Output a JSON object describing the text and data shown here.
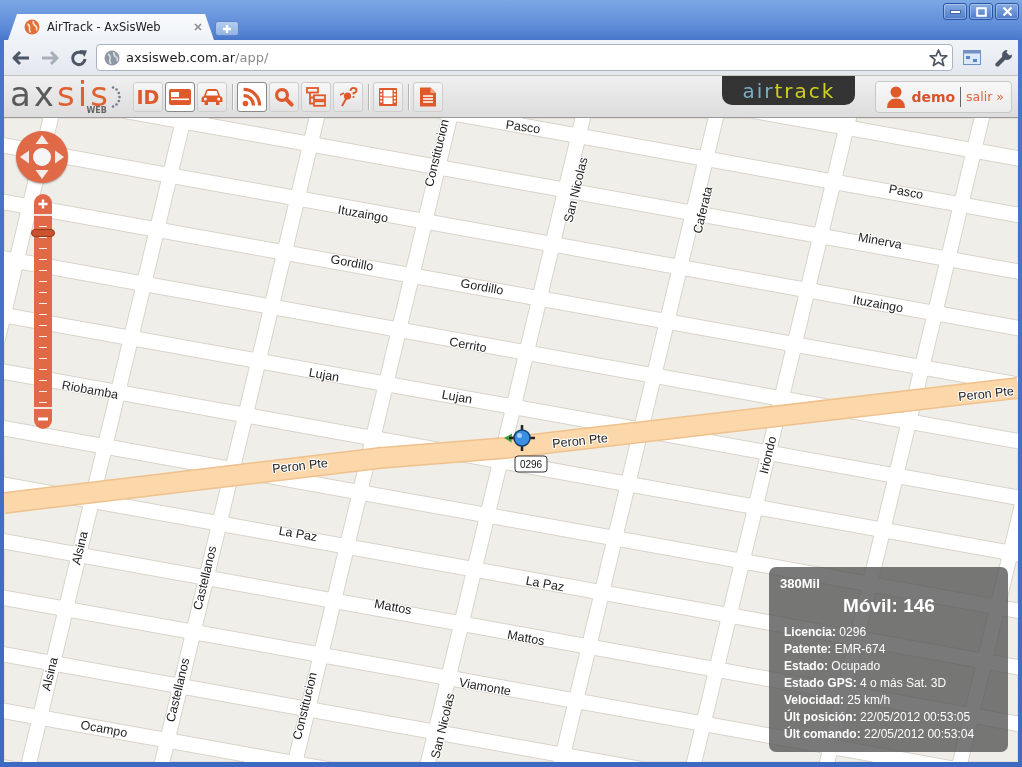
{
  "browser": {
    "tabs": [
      {
        "title": "AirTrack - AxSisWeb",
        "selected": true
      }
    ],
    "address": {
      "host": "axsisweb.com.ar",
      "path": "/app/"
    }
  },
  "app_bar": {
    "logo": {
      "parts": [
        "ax",
        "sis"
      ],
      "subtitle": "WEB"
    },
    "tool_groups": [
      [
        {
          "label": "ID",
          "selected": false
        },
        {
          "selected": true
        },
        {
          "selected": false
        }
      ],
      [
        {
          "selected": true
        },
        {
          "selected": false
        },
        {
          "selected": false
        },
        {
          "selected": false
        }
      ],
      [
        {
          "selected": false
        }
      ],
      [
        {
          "selected": false
        }
      ]
    ],
    "brand": {
      "parts": [
        "air",
        "track"
      ]
    },
    "user": {
      "name": "demo",
      "logout": "salir »"
    }
  },
  "map": {
    "zoom": {
      "level": 0.93
    },
    "street_labels": [
      "Pasco",
      "Constitucion",
      "San Nicolas",
      "Caferata",
      "Pasco",
      "Ituzaingo",
      "Minerva",
      "Gordillo",
      "Gordillo",
      "Ituzaingo",
      "Cerrito",
      "Lujan",
      "Lujan",
      "Riobamba",
      "Peron Pte",
      "Peron Pte",
      "Peron Pte",
      "Iriondo",
      "La Paz",
      "Alsina",
      "Castellanos",
      "La Paz",
      "Mattos",
      "Mattos",
      "Alsina",
      "Castellanos",
      "Viamonte",
      "Constitucion",
      "San Nicolas",
      "Ocampo"
    ],
    "vehicle": {
      "label": "0296"
    },
    "info_panel": {
      "header": "380Mil",
      "title": "Móvil: 146",
      "rows": [
        "**Licencia:** 0296",
        "**Patente:** EMR-674",
        "**Estado:** Ocupado",
        "**Estado GPS:** 4 o más Sat. 3D",
        "**Velocidad:** 25 km/h",
        "**Últ posición:** 22/05/2012 00:53:05",
        "**Últ comando:** 22/05/2012 00:53:04"
      ]
    }
  }
}
